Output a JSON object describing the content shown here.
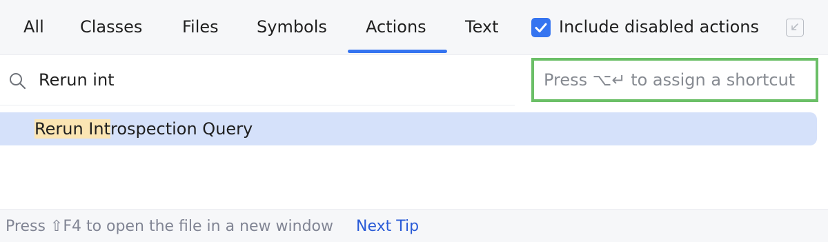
{
  "tabs": [
    {
      "label": "All"
    },
    {
      "label": "Classes"
    },
    {
      "label": "Files"
    },
    {
      "label": "Symbols"
    },
    {
      "label": "Actions",
      "selected": true
    },
    {
      "label": "Text"
    }
  ],
  "filter": {
    "checkbox_label": "Include disabled actions",
    "checked": true
  },
  "search": {
    "value": "Rerun int",
    "icon": "search-icon"
  },
  "shortcut_hint": "Press ⌥↵ to assign a shortcut",
  "results": [
    {
      "match": "Rerun Int",
      "rest": "rospection Query"
    }
  ],
  "footer": {
    "tip": "Press ⇧F4 to open the file in a new window",
    "next_tip": "Next Tip"
  },
  "colors": {
    "accent": "#3574f0",
    "selection": "#d5e1fa",
    "match_highlight": "#fbe5b3",
    "hint_border": "#6bbf67",
    "link": "#2a5bd7"
  }
}
